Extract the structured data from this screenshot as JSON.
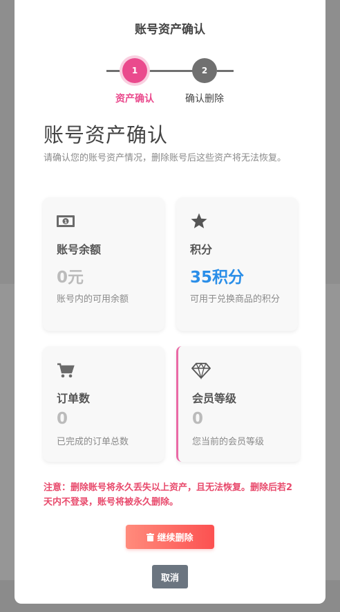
{
  "modal": {
    "title": "账号资产确认"
  },
  "steps": [
    {
      "number": "1",
      "label": "资产确认",
      "active": true
    },
    {
      "number": "2",
      "label": "确认删除",
      "active": false
    }
  ],
  "main": {
    "heading": "账号资产确认",
    "description": "请确认您的账号资产情况，删除账号后这些资产将无法恢复。"
  },
  "cards": [
    {
      "icon": "money-icon",
      "title": "账号余额",
      "value": "0元",
      "desc": "账号内的可用余额"
    },
    {
      "icon": "star-icon",
      "title": "积分",
      "value": "35积分",
      "desc": "可用于兑换商品的积分"
    },
    {
      "icon": "cart-icon",
      "title": "订单数",
      "value": "0",
      "desc": "已完成的订单总数"
    },
    {
      "icon": "diamond-icon",
      "title": "会员等级",
      "value": "0",
      "desc": "您当前的会员等级"
    }
  ],
  "warning": "注意：删除账号将永久丢失以上资产，且无法恢复。删除后若2天内不登录，账号将被永久删除。",
  "buttons": {
    "continue_label": "继续删除",
    "continue_icon": "trash-icon",
    "cancel_label": "取消"
  },
  "colors": {
    "accent_pink": "#ea4a8d",
    "points_blue": "#2a8ee8",
    "warning_red": "#e84a6c",
    "danger_gradient_start": "#ff8b7c",
    "danger_gradient_end": "#fc5151"
  }
}
